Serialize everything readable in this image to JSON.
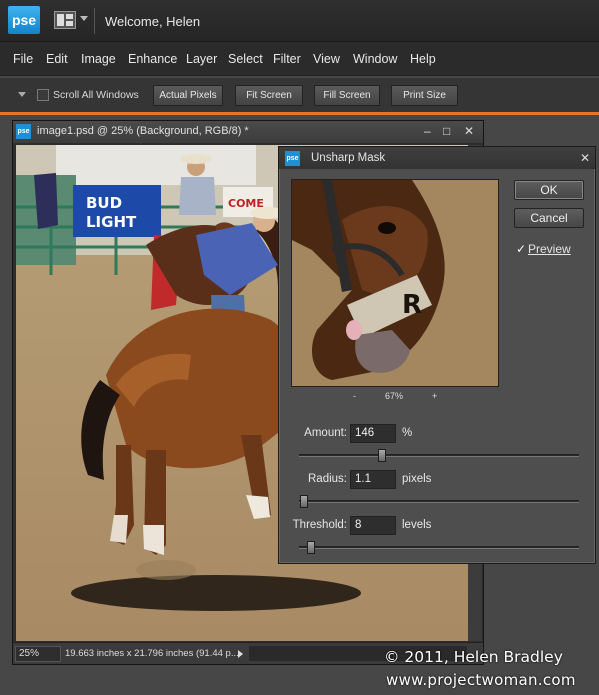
{
  "app": {
    "logo_text": "pse",
    "welcome": "Welcome, Helen",
    "layout_icon": "layout-panels-icon"
  },
  "menu": [
    "File",
    "Edit",
    "Image",
    "Enhance",
    "Layer",
    "Select",
    "Filter",
    "View",
    "Window",
    "Help"
  ],
  "options_bar": {
    "scroll_all_windows": "Scroll All Windows",
    "scroll_all_checked": false,
    "buttons": [
      "Actual Pixels",
      "Fit Screen",
      "Fill Screen",
      "Print Size"
    ],
    "accent_color": "#e2762a"
  },
  "document": {
    "icon_text": "pse",
    "title": "image1.psd @ 25% (Background, RGB/8) *",
    "zoom": "25%",
    "dimensions": "19.663 inches x 21.796 inches (91.44 p..."
  },
  "dialog": {
    "icon_text": "pse",
    "title": "Unsharp Mask",
    "ok_label": "OK",
    "cancel_label": "Cancel",
    "preview_label": "Preview",
    "preview_checked": true,
    "zoom_out": "-",
    "zoom_level": "67%",
    "zoom_in": "+",
    "amount": {
      "label": "Amount:",
      "value": "146",
      "unit": "%",
      "slider_fraction": 0.29
    },
    "radius": {
      "label": "Radius:",
      "value": "1.1",
      "unit": "pixels",
      "slider_fraction": 0.004
    },
    "threshold": {
      "label": "Threshold:",
      "value": "8",
      "unit": "levels",
      "slider_fraction": 0.03
    }
  },
  "watermark": {
    "copyright": "© 2011, Helen Bradley",
    "website": "www.projectwoman.com"
  }
}
